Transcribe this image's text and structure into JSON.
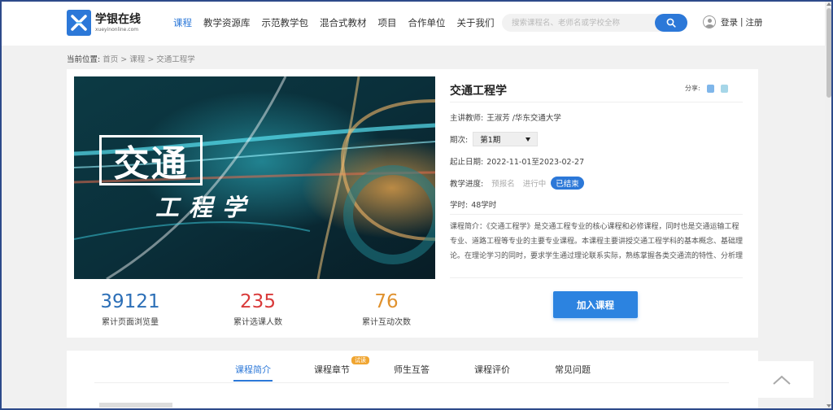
{
  "header": {
    "logo_cn": "学银在线",
    "logo_en": "xueyinonline.com",
    "nav": [
      {
        "label": "课程",
        "active": true
      },
      {
        "label": "教学资源库",
        "active": false
      },
      {
        "label": "示范教学包",
        "active": false
      },
      {
        "label": "混合式教材",
        "active": false
      },
      {
        "label": "项目",
        "active": false
      },
      {
        "label": "合作单位",
        "active": false
      },
      {
        "label": "关于我们",
        "active": false
      }
    ],
    "search_placeholder": "搜索课程名、老师名或学校全称",
    "login": "登录",
    "separator": "|",
    "register": "注册"
  },
  "breadcrumb": {
    "prefix": "当前位置:",
    "items": [
      "首页",
      "课程",
      "交通工程学"
    ],
    "sep": " > "
  },
  "cover": {
    "title": "交通",
    "subtitle": "工程学"
  },
  "stats": [
    {
      "value": "39121",
      "label": "累计页面浏览量",
      "color": "#2c6fb7"
    },
    {
      "value": "235",
      "label": "累计选课人数",
      "color": "#d93a3a"
    },
    {
      "value": "76",
      "label": "累计互动次数",
      "color": "#e0922f"
    }
  ],
  "course": {
    "title": "交通工程学",
    "share_label": "分享:",
    "teacher_label": "主讲教师:",
    "teacher": "王淑芳 /华东交通大学",
    "term_label": "期次:",
    "term_value": "第1期",
    "dates_label": "起止日期:",
    "dates": "2022-11-01至2023-02-27",
    "progress_label": "教学进度:",
    "progress": [
      "预报名",
      "进行中",
      "已结束"
    ],
    "progress_active": 2,
    "hours_label": "学时:",
    "hours": "48学时",
    "intro": "课程简介：《交通工程学》是交通工程专业的核心课程和必修课程，同时也是交通运输工程专业、道路工程等专业的主要专业课程。本课程主要讲授交通工程学科的基本概念、基础理论。在理论学习的同时，要求学生通过理论联系实际，熟练掌握各类交通流的特性、分析理论的基本原理和适用场合，掌握各类通行能力分析的方法及要点；同...",
    "join_button": "加入课程"
  },
  "tabs": {
    "items": [
      "课程简介",
      "课程章节",
      "师生互答",
      "课程评价",
      "常见问题"
    ],
    "active": 0,
    "badge": "试读"
  },
  "colors": {
    "brand": "#2c78d8",
    "join_button": "#2c83e0",
    "trial_badge": "#f0a531"
  }
}
